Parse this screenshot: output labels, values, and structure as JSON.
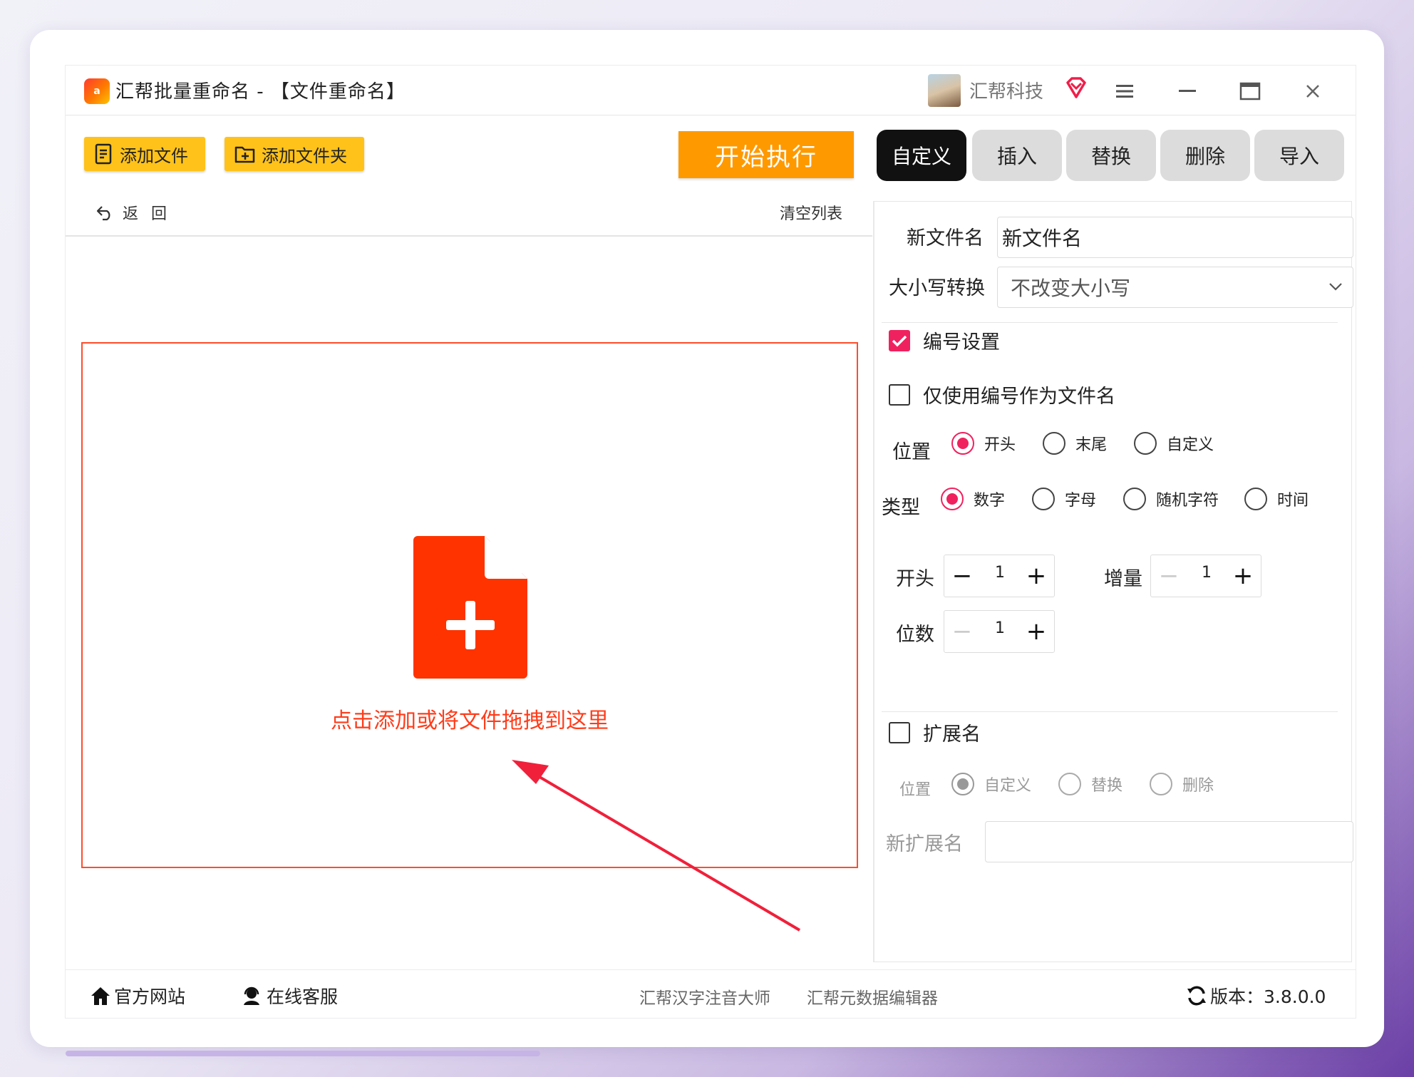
{
  "window": {
    "title": "汇帮批量重命名 - 【文件重命名】",
    "logo_text": "a",
    "company": "汇帮科技"
  },
  "toolbar": {
    "add_file_label": "添加文件",
    "add_folder_label": "添加文件夹",
    "start_label": "开始执行"
  },
  "tabs": [
    {
      "label": "自定义",
      "active": true
    },
    {
      "label": "插入",
      "active": false
    },
    {
      "label": "替换",
      "active": false
    },
    {
      "label": "删除",
      "active": false
    },
    {
      "label": "导入",
      "active": false
    }
  ],
  "file_list": {
    "back_label": "返回",
    "clear_label": "清空列表",
    "drop_hint": "点击添加或将文件拖拽到这里"
  },
  "settings": {
    "new_name_label": "新文件名",
    "new_name_value": "新文件名",
    "case_label": "大小写转换",
    "case_value": "不改变大小写",
    "numbering_label": "编号设置",
    "numbering_checked": true,
    "only_number_label": "仅使用编号作为文件名",
    "only_number_checked": false,
    "position_label": "位置",
    "position_options": [
      "开头",
      "末尾",
      "自定义"
    ],
    "position_selected": "开头",
    "type_label": "类型",
    "type_options": [
      "数字",
      "字母",
      "随机字符",
      "时间"
    ],
    "type_selected": "数字",
    "start_label": "开头",
    "start_value": "1",
    "increment_label": "增量",
    "increment_value": "1",
    "digits_label": "位数",
    "digits_value": "1",
    "extension_label": "扩展名",
    "extension_checked": false,
    "ext_position_label": "位置",
    "ext_position_options": [
      "自定义",
      "替换",
      "删除"
    ],
    "ext_position_selected": "自定义",
    "new_ext_label": "新扩展名",
    "new_ext_value": ""
  },
  "footer": {
    "website_label": "官方网站",
    "support_label": "在线客服",
    "link1": "汇帮汉字注音大师",
    "link2": "汇帮元数据编辑器",
    "version_label": "版本：3.8.0.0"
  },
  "colors": {
    "accent_pink": "#f0215f",
    "start_orange": "#ff9900",
    "add_yellow": "#ffc21a",
    "drop_red": "#ff3c1a"
  }
}
